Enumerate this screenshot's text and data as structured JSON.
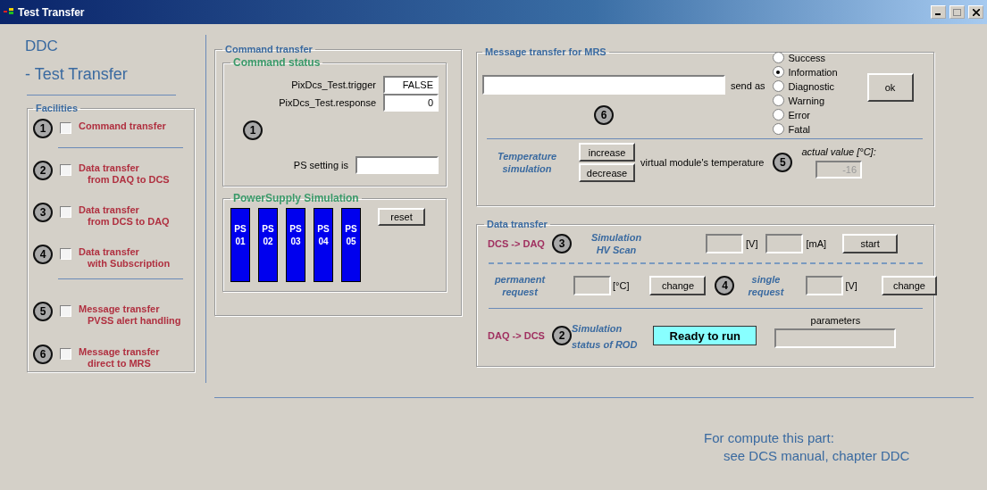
{
  "window": {
    "title": "Test Transfer"
  },
  "header": {
    "title": "DDC",
    "subtitle": "- Test Transfer"
  },
  "facilities": {
    "title": "Facilities",
    "groups": [
      [
        {
          "number": "1",
          "lines": [
            "Command transfer"
          ],
          "checked": false
        }
      ],
      [
        {
          "number": "2",
          "lines": [
            "Data transfer",
            "from DAQ to DCS"
          ],
          "checked": false
        },
        {
          "number": "3",
          "lines": [
            "Data transfer",
            "from DCS to DAQ"
          ],
          "checked": false
        },
        {
          "number": "4",
          "lines": [
            "Data transfer",
            "with Subscription"
          ],
          "checked": false
        }
      ],
      [
        {
          "number": "5",
          "lines": [
            "Message transfer",
            "PVSS alert handling"
          ],
          "checked": false
        },
        {
          "number": "6",
          "lines": [
            "Message transfer",
            "direct to MRS"
          ],
          "checked": false
        }
      ]
    ]
  },
  "command_transfer": {
    "title": "Command transfer",
    "status": {
      "title": "Command status",
      "fields": [
        {
          "label": "PixDcs_Test.trigger",
          "value": "FALSE"
        },
        {
          "label": "PixDcs_Test.response",
          "value": "0"
        }
      ],
      "badge": "1",
      "ps_setting_label": "PS setting is"
    },
    "power_supply": {
      "title": "PowerSupply Simulation",
      "units": [
        [
          "PS",
          "01"
        ],
        [
          "PS",
          "02"
        ],
        [
          "PS",
          "03"
        ],
        [
          "PS",
          "04"
        ],
        [
          "PS",
          "05"
        ]
      ],
      "reset": "reset"
    }
  },
  "message_transfer": {
    "title": "Message transfer for MRS",
    "send_as": "send as",
    "badge": "6",
    "options": [
      {
        "label": "Success",
        "selected": false
      },
      {
        "label": "Information",
        "selected": true
      },
      {
        "label": "Diagnostic",
        "selected": false
      },
      {
        "label": "Warning",
        "selected": false
      },
      {
        "label": "Error",
        "selected": false
      },
      {
        "label": "Fatal",
        "selected": false
      }
    ],
    "ok": "ok",
    "temperature": {
      "title": [
        "Temperature",
        "simulation"
      ],
      "increase": "increase",
      "decrease": "decrease",
      "caption": "virtual module's temperature",
      "badge": "5",
      "actual_label": "actual value [°C]:",
      "actual_value": "-16",
      "disabled": true
    }
  },
  "data_transfer": {
    "title": "Data transfer",
    "hv_scan": {
      "direction": "DCS -> DAQ",
      "badge": "3",
      "title": [
        "Simulation",
        "HV Scan"
      ],
      "units": [
        "[V]",
        "[mA]"
      ],
      "button": "start"
    },
    "requests": {
      "permanent": [
        "permanent",
        "request"
      ],
      "permanent_unit": "[°C]",
      "permanent_button": "change",
      "badge": "4",
      "single": [
        "single",
        "request"
      ],
      "single_unit": "[V]",
      "single_button": "change"
    },
    "rod": {
      "direction": "DAQ -> DCS",
      "badge": "2",
      "title": [
        "Simulation",
        "status of ROD"
      ],
      "status": "Ready to run",
      "parameters_label": "parameters"
    }
  },
  "footer": [
    "For compute this part:",
    "see DCS manual, chapter DDC"
  ]
}
